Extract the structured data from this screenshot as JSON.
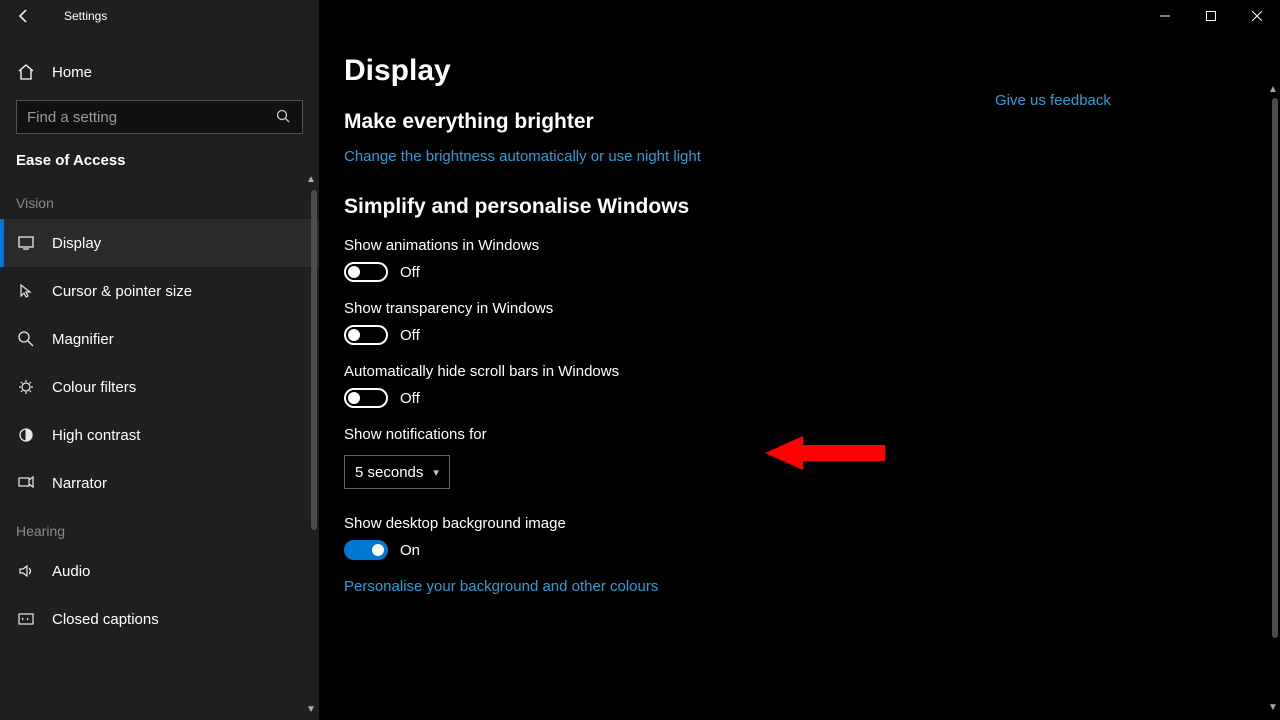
{
  "titlebar": {
    "appname": "Settings"
  },
  "sidebar": {
    "home": "Home",
    "search_placeholder": "Find a setting",
    "category": "Ease of Access",
    "groups": [
      {
        "label": "Vision",
        "items": [
          {
            "id": "display",
            "label": "Display",
            "selected": true
          },
          {
            "id": "cursor",
            "label": "Cursor & pointer size"
          },
          {
            "id": "magnifier",
            "label": "Magnifier"
          },
          {
            "id": "colour-filters",
            "label": "Colour filters"
          },
          {
            "id": "high-contrast",
            "label": "High contrast"
          },
          {
            "id": "narrator",
            "label": "Narrator"
          }
        ]
      },
      {
        "label": "Hearing",
        "items": [
          {
            "id": "audio",
            "label": "Audio"
          },
          {
            "id": "closed-captions",
            "label": "Closed captions"
          }
        ]
      }
    ]
  },
  "main": {
    "title": "Display",
    "feedback": "Give us feedback",
    "section_brighter": {
      "heading": "Make everything brighter",
      "link": "Change the brightness automatically or use night light"
    },
    "section_simplify": {
      "heading": "Simplify and personalise Windows",
      "opt_animations": {
        "label": "Show animations in Windows",
        "state": "Off",
        "on": false
      },
      "opt_transparency": {
        "label": "Show transparency in Windows",
        "state": "Off",
        "on": false
      },
      "opt_scrollbars": {
        "label": "Automatically hide scroll bars in Windows",
        "state": "Off",
        "on": false
      },
      "opt_notifications": {
        "label": "Show notifications for",
        "value": "5 seconds"
      },
      "opt_desktopbg": {
        "label": "Show desktop background image",
        "state": "On",
        "on": true
      },
      "link_personalise": "Personalise your background and other colours"
    }
  }
}
